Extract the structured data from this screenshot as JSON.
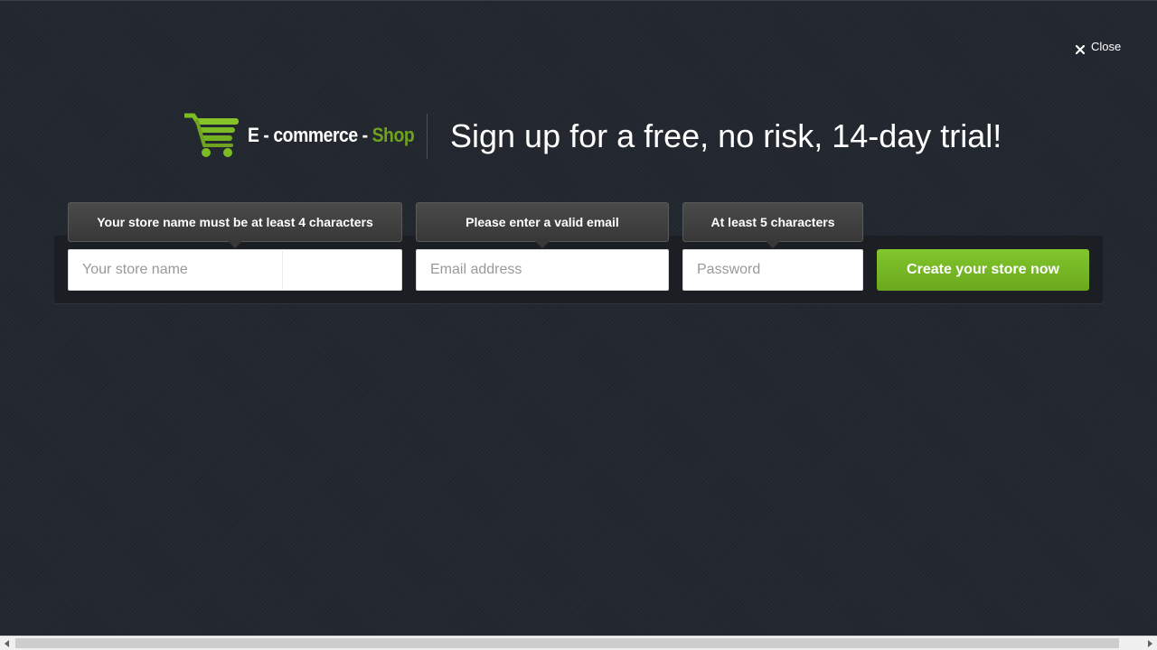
{
  "close": {
    "label": "Close",
    "icon": "close-icon"
  },
  "brand": {
    "logo_icon": "shopping-cart-icon",
    "name_prefix": "E - commerce - ",
    "name_suffix": "Shop",
    "accent_color": "#6ea21f"
  },
  "headline": "Sign up for a free, no risk, 14-day trial!",
  "form": {
    "store_name": {
      "placeholder": "Your store name",
      "value": "",
      "tooltip": "Your store name must be at least 4 characters"
    },
    "email": {
      "placeholder": "Email address",
      "value": "",
      "tooltip": "Please enter a valid email"
    },
    "password": {
      "placeholder": "Password",
      "value": "",
      "tooltip": "At least 5 characters"
    },
    "submit_label": "Create your store now",
    "submit_color": "#76b626"
  },
  "colors": {
    "background": "#232830",
    "panel": "#1b1e23",
    "tooltip": "#404040"
  }
}
